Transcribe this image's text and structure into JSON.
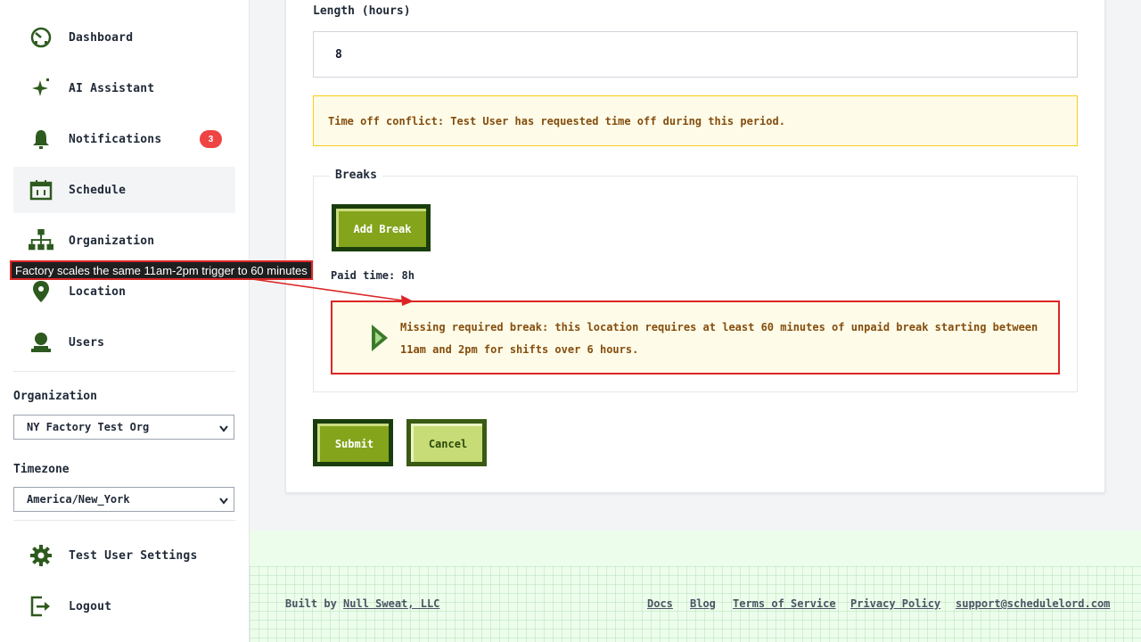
{
  "sidebar": {
    "items": [
      {
        "label": "Dashboard",
        "icon": "dashboard-icon"
      },
      {
        "label": "AI Assistant",
        "icon": "sparkle-icon"
      },
      {
        "label": "Notifications",
        "icon": "bell-icon",
        "badge": "3"
      },
      {
        "label": "Schedule",
        "icon": "calendar-icon",
        "active": true
      },
      {
        "label": "Organization",
        "icon": "org-chart-icon"
      },
      {
        "label": "Location",
        "icon": "location-pin-icon"
      },
      {
        "label": "Users",
        "icon": "user-icon"
      }
    ],
    "organization_label": "Organization",
    "organization_value": "NY Factory Test Org",
    "timezone_label": "Timezone",
    "timezone_value": "America/New_York",
    "settings_label": "Test User Settings",
    "logout_label": "Logout"
  },
  "form": {
    "length_label": "Length (hours)",
    "length_value": "8",
    "conflict_text": "Time off conflict: Test User has requested time off during this period.",
    "breaks_legend": "Breaks",
    "add_break_label": "Add Break",
    "paid_time": "Paid time: 8h",
    "warning_text": "Missing required break: this location requires at least 60 minutes of unpaid break starting between 11am and 2pm for shifts over 6 hours.",
    "submit_label": "Submit",
    "cancel_label": "Cancel"
  },
  "footer": {
    "built_by": "Built by",
    "company": "Null Sweat, LLC",
    "links": [
      "Docs",
      "Blog",
      "Terms of Service",
      "Privacy Policy",
      "support@schedulelord.com"
    ]
  },
  "annotation": {
    "text": "Factory scales the same 11am-2pm trigger to 60 minutes"
  },
  "colors": {
    "brand_dark": "#1a3d0d",
    "brand": "#84a41c",
    "icon_green": "#2d5a1e",
    "badge_red": "#ef4444",
    "warning_border": "#dc2626"
  }
}
